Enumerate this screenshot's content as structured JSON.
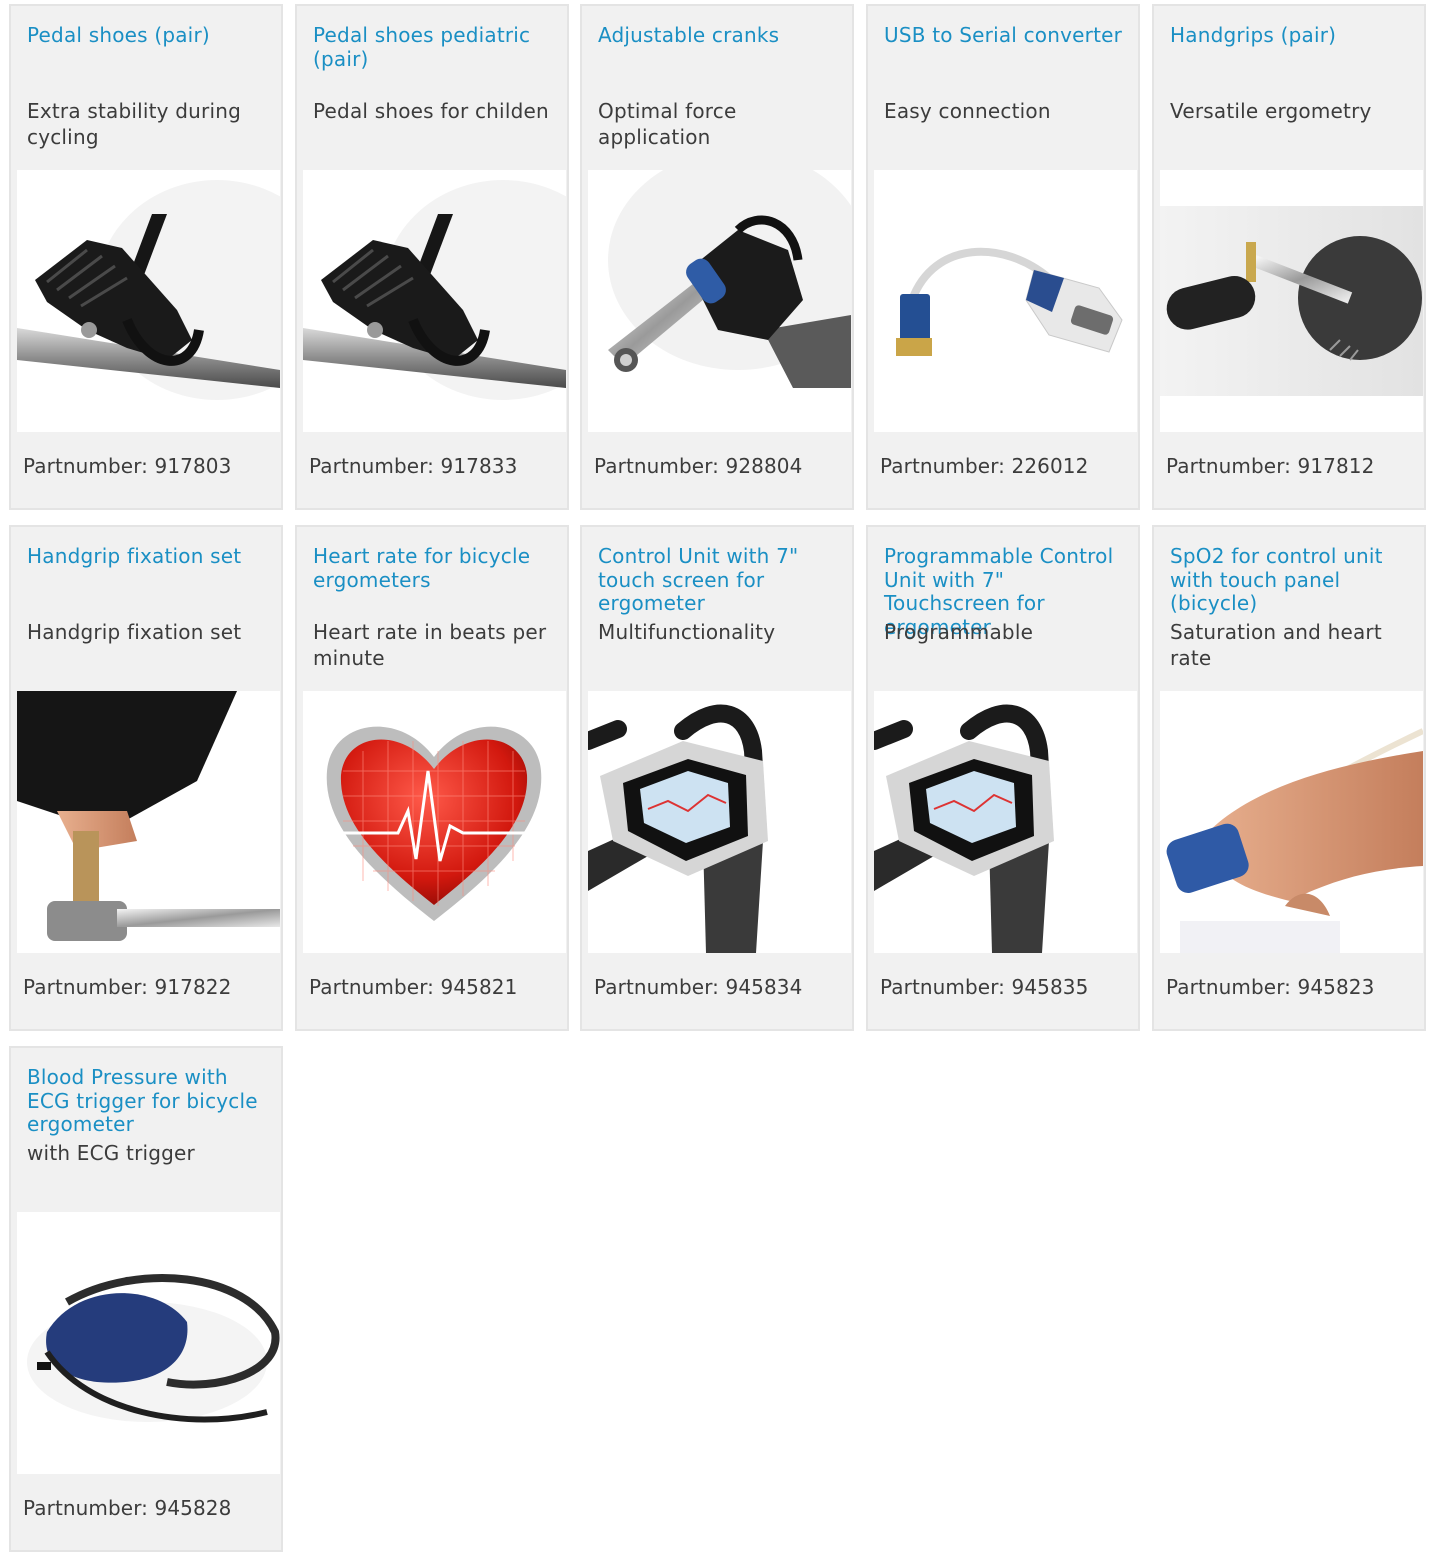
{
  "products": [
    {
      "title": "Pedal shoes (pair)",
      "subtitle": "Extra stability during cycling",
      "part_label": "Partnumber:",
      "part_number": "917803",
      "icon": "pedal-shoe-icon"
    },
    {
      "title": "Pedal shoes pediatric (pair)",
      "subtitle": "Pedal shoes for childen",
      "part_label": "Partnumber:",
      "part_number": "917833",
      "icon": "pedal-shoe-icon"
    },
    {
      "title": "Adjustable cranks",
      "subtitle": "Optimal force application",
      "part_label": "Partnumber:",
      "part_number": "928804",
      "icon": "crank-icon"
    },
    {
      "title": "USB to Serial converter",
      "subtitle": "Easy connection",
      "part_label": "Partnumber:",
      "part_number": "226012",
      "icon": "usb-serial-icon"
    },
    {
      "title": "Handgrips (pair)",
      "subtitle": "Versatile ergometry",
      "part_label": "Partnumber:",
      "part_number": "917812",
      "icon": "handgrip-icon"
    },
    {
      "title": "Handgrip fixation set",
      "subtitle": "Handgrip fixation set",
      "part_label": "Partnumber:",
      "part_number": "917822",
      "icon": "fixation-set-icon"
    },
    {
      "title": "Heart rate for bicycle ergometers",
      "subtitle": "Heart rate in beats per minute",
      "part_label": "Partnumber:",
      "part_number": "945821",
      "icon": "heart-icon"
    },
    {
      "title": "Control Unit with 7\" touch screen for ergometer",
      "subtitle": "Multifunctionality",
      "part_label": "Partnumber:",
      "part_number": "945834",
      "icon": "control-unit-icon"
    },
    {
      "title": "Programmable Control Unit with 7\" Touchscreen for ergometer",
      "subtitle": "Programmable",
      "part_label": "Partnumber:",
      "part_number": "945835",
      "icon": "control-unit-icon"
    },
    {
      "title": "SpO2 for control unit with touch panel (bicycle)",
      "subtitle": "Saturation and heart rate",
      "part_label": "Partnumber:",
      "part_number": "945823",
      "icon": "finger-sensor-icon"
    },
    {
      "title": "Blood Pressure with ECG trigger for bicycle ergometer",
      "subtitle": "with ECG trigger",
      "part_label": "Partnumber:",
      "part_number": "945828",
      "icon": "blood-pressure-cuff-icon"
    }
  ],
  "colors": {
    "title": "#1a8fc4",
    "text": "#3c3c3c",
    "card_bg": "#f1f1f1",
    "card_border": "#e4e4e4"
  }
}
